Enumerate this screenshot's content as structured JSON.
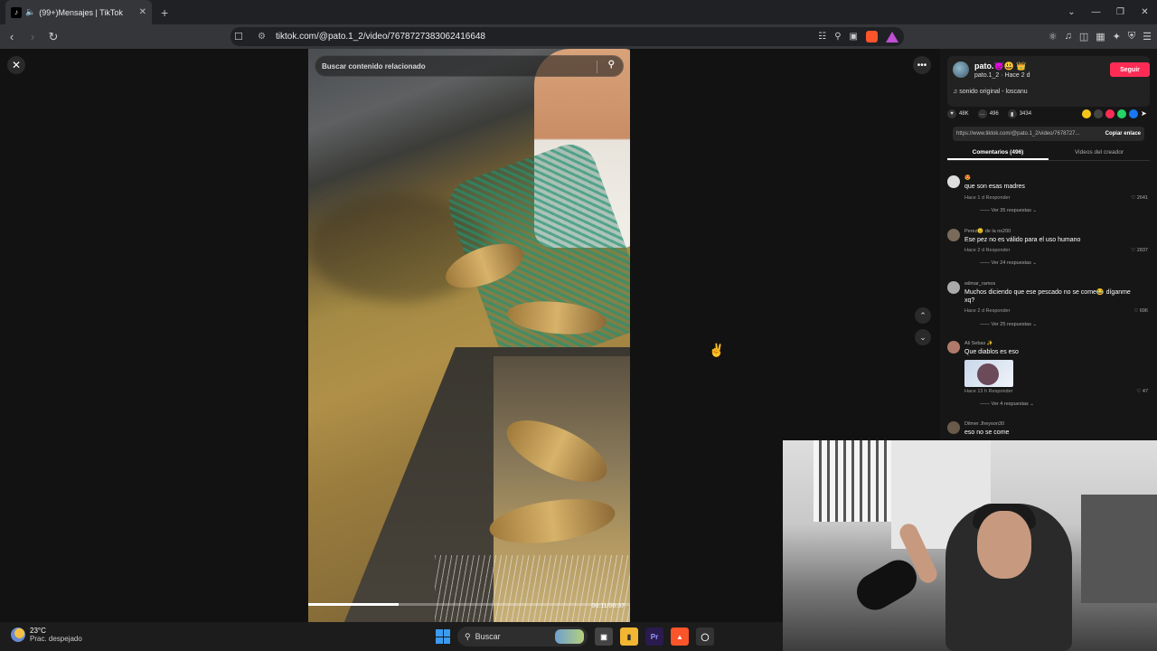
{
  "browser": {
    "tab_title": "(99+)Mensajes | TikTok",
    "url": "tiktok.com/@pato.1_2/video/7678727383062416648",
    "new_tab": "+"
  },
  "viewer": {
    "search_placeholder": "Buscar contenido relacionado",
    "progress": 0.28,
    "time": "00:11/00:37"
  },
  "author": {
    "username": "pato.😈😃 👑",
    "sub": "pato.1_2 · Hace 2 d",
    "follow": "Seguir",
    "music": "♫  sonido original - loscanu"
  },
  "stats": {
    "likes": "48K",
    "comments": "496",
    "saves": "3434"
  },
  "link": {
    "url": "https://www.tiktok.com/@pato.1_2/video/7678727...",
    "copy": "Copiar enlace"
  },
  "tabs": {
    "comments": "Comentarios (496)",
    "creator": "Videos del creador"
  },
  "comments": [
    {
      "name": "😍",
      "text": "que son esas madres",
      "meta": "Hace 1 d   Responder",
      "likes": "♡ 2641",
      "replies": "—— Ver 35 respuestas ⌄"
    },
    {
      "name": "Perez😐  de la ns200",
      "text": "Ese pez no es válido para el uso humano",
      "meta": "Hace 2 d   Responder",
      "likes": "♡ 2837",
      "replies": "—— Ver 24 respuestas ⌄"
    },
    {
      "name": "wilmar_ramos",
      "text": "Muchos diciendo que ese pescado no se come😂 díganme xq?",
      "meta": "Hace 2 d   Responder",
      "likes": "♡ 696",
      "replies": "—— Ver 25 respuestas ⌄"
    },
    {
      "name": "Ali Sebas ✨",
      "text": "Que diablos es eso",
      "meta": "Hace 13 h   Responder",
      "likes": "♡ 47",
      "replies": "—— Ver 4 respuestas ⌄"
    },
    {
      "name": "Dilmer Jheyson30",
      "text": "eso no se come",
      "meta": "",
      "likes": "",
      "replies": ""
    }
  ],
  "taskbar": {
    "temp": "23°C",
    "weather": "Prac. despejado",
    "search": "Buscar"
  },
  "colors": {
    "follow": "#fe2c55",
    "accent_blue": "#3a9bf0"
  }
}
